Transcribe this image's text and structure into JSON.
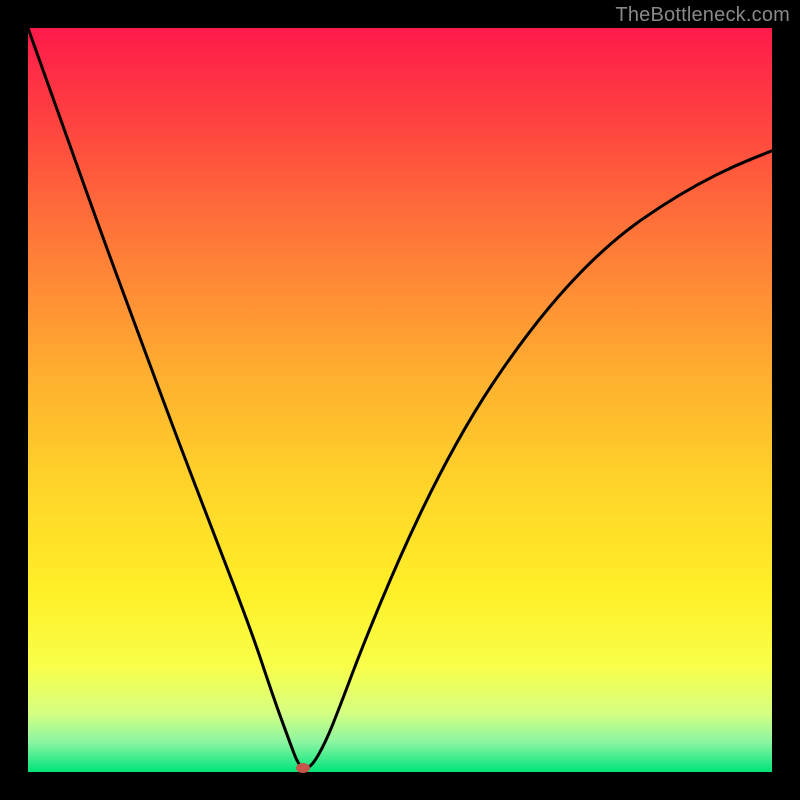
{
  "watermark": "TheBottleneck.com",
  "colors": {
    "bg": "#000000",
    "gradient_top": "#ff1a4b",
    "gradient_bottom": "#00e47a",
    "curve": "#000000",
    "marker": "#c6564b"
  },
  "chart_data": {
    "type": "line",
    "title": "",
    "xlabel": "",
    "ylabel": "",
    "xlim": [
      0,
      100
    ],
    "ylim": [
      0,
      100
    ],
    "series": [
      {
        "name": "bottleneck-curve",
        "x": [
          0,
          5,
          10,
          15,
          20,
          25,
          30,
          33,
          35,
          36.5,
          38,
          40,
          42,
          45,
          50,
          55,
          60,
          65,
          70,
          75,
          80,
          85,
          90,
          95,
          100
        ],
        "y": [
          100,
          86,
          72,
          58.5,
          45,
          32,
          19,
          10,
          4.5,
          0.5,
          0.5,
          4,
          9,
          17,
          29,
          39.5,
          48.5,
          56,
          62.5,
          68,
          72.5,
          76,
          79,
          81.5,
          83.5
        ]
      }
    ],
    "marker": {
      "x": 37,
      "y": 0.5
    },
    "grid": false,
    "legend": false
  }
}
